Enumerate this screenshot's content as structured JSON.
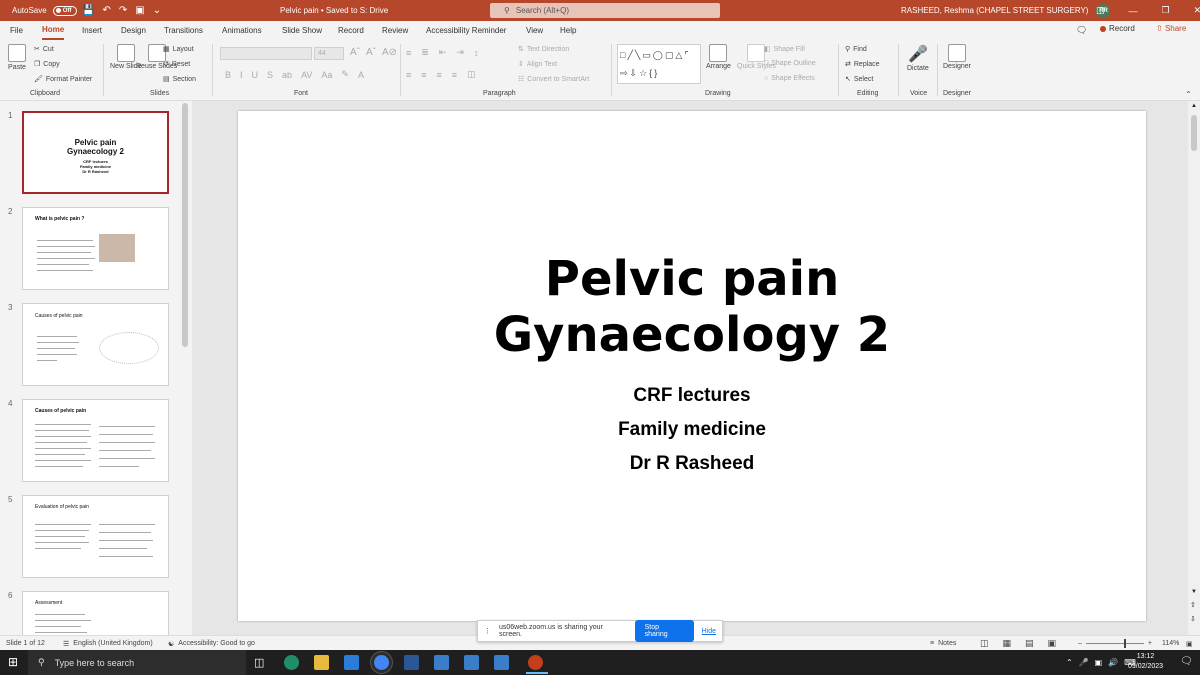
{
  "titlebar": {
    "autosave_label": "AutoSave",
    "autosave_state": "Off",
    "doc_title": "Pelvic pain • Saved to S: Drive",
    "search_placeholder": "Search (Alt+Q)",
    "user_name": "RASHEED, Reshma (CHAPEL STREET SURGERY)",
    "user_initials": "RR"
  },
  "menu": {
    "tabs": [
      "File",
      "Home",
      "Insert",
      "Design",
      "Transitions",
      "Animations",
      "Slide Show",
      "Record",
      "Review",
      "Accessibility Reminder",
      "View",
      "Help"
    ],
    "active": "Home",
    "record_label": "Record",
    "share_label": "Share"
  },
  "ribbon": {
    "clipboard": {
      "paste": "Paste",
      "cut": "Cut",
      "copy": "Copy",
      "format_painter": "Format Painter",
      "label": "Clipboard"
    },
    "slides": {
      "new_slide": "New Slide",
      "reuse_slides": "Reuse Slides",
      "layout": "Layout",
      "reset": "Reset",
      "section": "Section",
      "label": "Slides"
    },
    "font": {
      "size": "44",
      "label": "Font"
    },
    "paragraph": {
      "text_direction": "Text Direction",
      "align_text": "Align Text",
      "convert_smartart": "Convert to SmartArt",
      "label": "Paragraph"
    },
    "drawing": {
      "arrange": "Arrange",
      "quick_styles": "Quick Styles",
      "shape_fill": "Shape Fill",
      "shape_outline": "Shape Outline",
      "shape_effects": "Shape Effects",
      "label": "Drawing"
    },
    "editing": {
      "find": "Find",
      "replace": "Replace",
      "select": "Select",
      "label": "Editing"
    },
    "voice": {
      "dictate": "Dictate",
      "label": "Voice"
    },
    "designer": {
      "designer": "Designer",
      "label": "Designer"
    }
  },
  "thumbnails": [
    {
      "num": "1",
      "title": "Pelvic pain\nGynaecology 2",
      "sub": "CRF lectures\nFamily medicine\nDr R Rasheed"
    },
    {
      "num": "2",
      "title": "What is pelvic pain ?"
    },
    {
      "num": "3",
      "title": "Causes of pelvic pain"
    },
    {
      "num": "4",
      "title": "Causes of pelvic pain"
    },
    {
      "num": "5",
      "title": "Evaluation of pelvic pain"
    },
    {
      "num": "6",
      "title": "Assessment"
    }
  ],
  "slide": {
    "title_line1": "Pelvic pain",
    "title_line2": "Gynaecology 2",
    "sub1": "CRF lectures",
    "sub2": "Family medicine",
    "sub3": "Dr R Rasheed"
  },
  "status": {
    "slide_count": "Slide 1 of 12",
    "language": "English (United Kingdom)",
    "accessibility": "Accessibility: Good to go",
    "notes": "Notes",
    "zoom": "114%"
  },
  "share_banner": {
    "text": "us06web.zoom.us is sharing your screen.",
    "stop": "Stop sharing",
    "hide": "Hide"
  },
  "taskbar": {
    "search_placeholder": "Type here to search",
    "time": "13:12",
    "date": "09/02/2023"
  }
}
